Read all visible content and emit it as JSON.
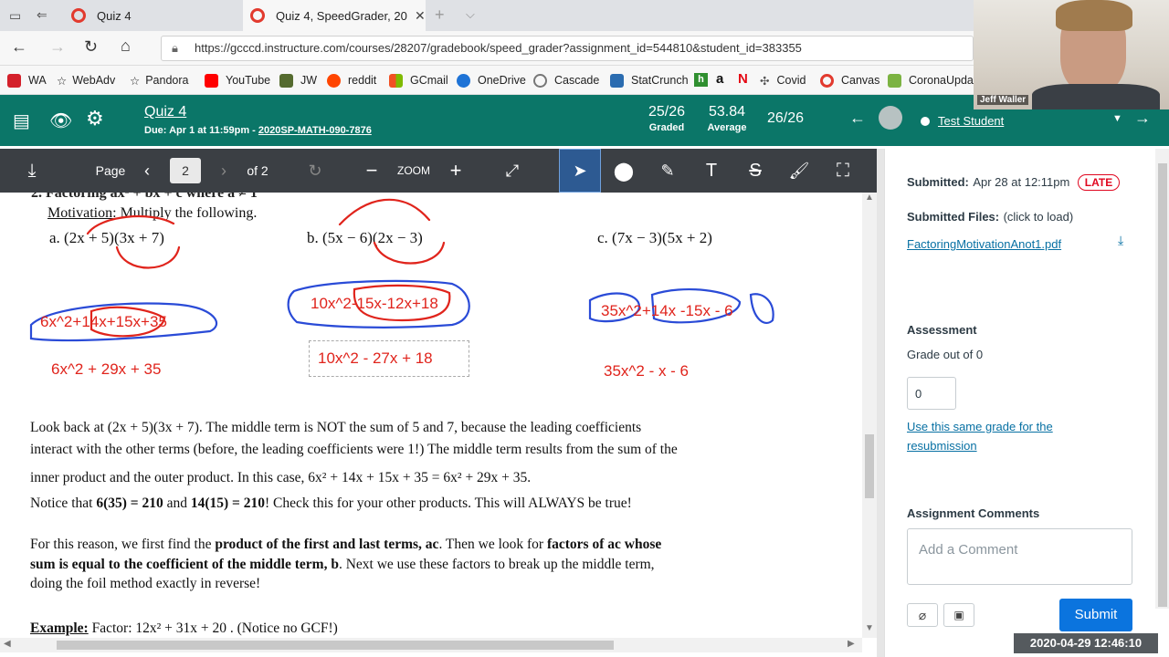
{
  "browser": {
    "tabs": [
      {
        "title": "Quiz 4",
        "active": false
      },
      {
        "title": "Quiz 4, SpeedGrader, 20",
        "active": true
      }
    ],
    "url": "https://gcccd.instructure.com/courses/28207/gradebook/speed_grader?assignment_id=544810&student_id=383355",
    "favorites": [
      "WA",
      "WebAdv",
      "Pandora",
      "YouTube",
      "JW",
      "reddit",
      "GCmail",
      "OneDrive",
      "Cascade",
      "StatCrunch",
      "Covid",
      "Canvas",
      "CoronaUpdat"
    ]
  },
  "webcam": {
    "name": "Jeff Waller"
  },
  "header": {
    "assignment": "Quiz 4",
    "due": "Due: Apr 1 at 11:59pm - ",
    "course": "2020SP-MATH-090-7876",
    "graded_value": "25/26",
    "graded_label": "Graded",
    "average_value": "53.84",
    "average_label": "Average",
    "student_count": "26/26",
    "student_name": "Test Student"
  },
  "viewer": {
    "page_label": "Page",
    "page_value": "2",
    "of_label": "of 2",
    "zoom_label": "ZOOM"
  },
  "doc": {
    "heading_partial": "2. Factoring  ax² + bx + c  where a ≠ 1",
    "motivation_prefix": "Motivation:",
    "motivation_rest": " Multiply the following.",
    "problem_a": "a.  (2x + 5)(3x + 7)",
    "problem_b": "b.  (5x − 6)(2x − 3)",
    "problem_c": "c.  (7x − 3)(5x + 2)",
    "work_a": "6x^2+14x+15x+35",
    "answer_a": "6x^2 + 29x + 35",
    "work_b": "10x^2-15x-12x+18",
    "answer_b": "10x^2 - 27x + 18",
    "work_c": "35x^2+14x -15x - 6",
    "answer_c": "35x^2 - x - 6",
    "para1_line1": "Look back at (2x + 5)(3x + 7). The middle term is NOT the sum of 5 and 7, because the leading coefficients",
    "para1_line2": "interact with the other terms (before, the leading coefficients were 1!) The middle term results from the sum of the",
    "para1_line3": "inner product and the outer product. In this case,  6x² + 14x + 15x + 35 = 6x² + 29x + 35.",
    "para1_line4_pre": "Notice that ",
    "para1_line4_b1": "6(35) = 210",
    "para1_line4_mid": " and ",
    "para1_line4_b2": "14(15) = 210",
    "para1_line4_post": "! Check this for your other products. This will ALWAYS be true!",
    "para2_line1_pre": "For this reason, we first find the ",
    "para2_line1_b1": "product of the first and last terms, ac",
    "para2_line1_mid": ". Then we look for ",
    "para2_line1_b2": "factors of ac whose",
    "para2_line2_b": "sum is equal to the coefficient of the middle term, b",
    "para2_line2_post": ". Next we use these factors to break up the middle term,",
    "para2_line3": "doing the foil method exactly in reverse!",
    "example_label": "Example:",
    "example_text": " Factor: 12x² + 31x + 20 . (Notice no GCF!)"
  },
  "sidebar": {
    "submitted_label": "Submitted:",
    "submitted_date": "Apr 28 at 12:11pm",
    "late_badge": "LATE",
    "files_label": "Submitted Files:",
    "files_hint": "(click to load)",
    "file_name": "FactoringMotivationAnot1.pdf",
    "assessment_title": "Assessment",
    "grade_label": "Grade out of 0",
    "grade_value": "0",
    "resubmission_link": "Use this same grade for the resubmission",
    "comments_title": "Assignment Comments",
    "comment_placeholder": "Add a Comment",
    "submit_label": "Submit"
  },
  "timestamp": "2020-04-29  12:46:10",
  "colors": {
    "canvas_green": "#0b7668",
    "annotation_red": "#e0241c",
    "annotation_blue": "#2a4bd7",
    "submit_blue": "#0b74de"
  }
}
